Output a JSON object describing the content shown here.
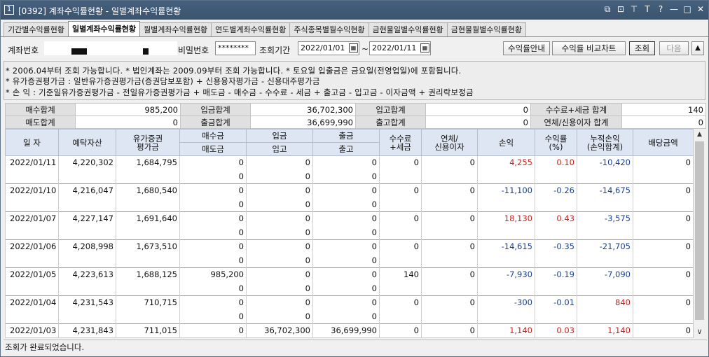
{
  "window": {
    "num": "1",
    "title": "[0392] 계좌수익률현황 - 일별계좌수익률현황",
    "buttons": [
      "⧉",
      "⊡",
      "⊤",
      "T",
      "?",
      "—",
      "□",
      "✕"
    ]
  },
  "tabs": [
    "기간별수익률현황",
    "일별계좌수익률현황",
    "월별계좌수익률현황",
    "연도별계좌수익률현황",
    "주식종목별월수익현황",
    "금현물일별수익률현황",
    "금현물월별수익률현황"
  ],
  "form": {
    "account_label": "계좌번호",
    "password_label": "비밀번호",
    "password_value": "********",
    "period_label": "조회기간",
    "date_from": "2022/01/01",
    "date_to": "2022/01/11",
    "tilde": "~",
    "cal_icon": "▦",
    "btn_guide": "수익률안내",
    "btn_compare": "수익률 비교차트",
    "btn_query": "조회",
    "btn_next": "다음",
    "btn_up": "▲"
  },
  "notes": [
    "* 2006.04부터 조회 가능합니다.   * 법인계좌는 2009.09부터 조회 가능합니다.   * 토요일 입출금은 금요일(전영업일)에 포함됩니다.",
    "* 유가증권평가금 : 일반유가증권평가금(증권담보포함) + 신용융자평가금 - 신용대주평가금",
    "* 손        익 : 기준일유가증권평가금 - 전일유가증권평가금 + 매도금 - 매수금 - 수수료 - 세금 + 출고금 - 입고금 - 이자금액 + 권리락보정금"
  ],
  "summary": [
    {
      "l1": "매수합계",
      "v1": "985,200",
      "l2": "입금합계",
      "v2": "36,702,300",
      "l3": "입고합계",
      "v3": "0",
      "l4": "수수료+세금 합계",
      "v4": "140"
    },
    {
      "l1": "매도합계",
      "v1": "0",
      "l2": "출금합계",
      "v2": "36,699,990",
      "l3": "출고합계",
      "v3": "0",
      "l4": "연체/신용이자 합계",
      "v4": "0"
    }
  ],
  "headers": {
    "date": "일 자",
    "deposit": "예탁자산",
    "sec_eval": "유가증권\n평가금",
    "buy": "매수금",
    "sell": "매도금",
    "in": "입금",
    "in2": "입고",
    "out": "출금",
    "out2": "출고",
    "fee": "수수료\n+세금",
    "interest": "연체/\n신용이자",
    "pl": "손익",
    "rate": "수익률\n(%)",
    "cum": "누적손익\n(손익합계)",
    "div": "배당금액"
  },
  "rows": [
    {
      "date": "2022/01/11",
      "deposit": "4,220,302",
      "eval": "1,684,795",
      "buy": "0",
      "sell": "0",
      "dep": "0",
      "inq": "0",
      "wd": "0",
      "outq": "0",
      "fee": "0",
      "int": "0",
      "pl": "4,255",
      "rate": "0.10",
      "cum": "-10,420",
      "div": "0",
      "pl_c": "red",
      "rate_c": "red",
      "cum_c": "blue"
    },
    {
      "date": "2022/01/10",
      "deposit": "4,216,047",
      "eval": "1,680,540",
      "buy": "0",
      "sell": "0",
      "dep": "0",
      "inq": "0",
      "wd": "0",
      "outq": "0",
      "fee": "0",
      "int": "0",
      "pl": "-11,100",
      "rate": "-0.26",
      "cum": "-14,675",
      "div": "0",
      "pl_c": "blue",
      "rate_c": "blue",
      "cum_c": "blue"
    },
    {
      "date": "2022/01/07",
      "deposit": "4,227,147",
      "eval": "1,691,640",
      "buy": "0",
      "sell": "0",
      "dep": "0",
      "inq": "0",
      "wd": "0",
      "outq": "0",
      "fee": "0",
      "int": "0",
      "pl": "18,130",
      "rate": "0.43",
      "cum": "-3,575",
      "div": "0",
      "pl_c": "red",
      "rate_c": "red",
      "cum_c": "blue"
    },
    {
      "date": "2022/01/06",
      "deposit": "4,208,998",
      "eval": "1,673,510",
      "buy": "0",
      "sell": "0",
      "dep": "0",
      "inq": "0",
      "wd": "0",
      "outq": "0",
      "fee": "0",
      "int": "0",
      "pl": "-14,615",
      "rate": "-0.35",
      "cum": "-21,705",
      "div": "0",
      "pl_c": "blue",
      "rate_c": "blue",
      "cum_c": "blue"
    },
    {
      "date": "2022/01/05",
      "deposit": "4,223,613",
      "eval": "1,688,125",
      "buy": "985,200",
      "sell": "0",
      "dep": "0",
      "inq": "0",
      "wd": "0",
      "outq": "0",
      "fee": "140",
      "int": "0",
      "pl": "-7,930",
      "rate": "-0.19",
      "cum": "-7,090",
      "div": "0",
      "pl_c": "blue",
      "rate_c": "blue",
      "cum_c": "blue"
    },
    {
      "date": "2022/01/04",
      "deposit": "4,231,543",
      "eval": "710,715",
      "buy": "0",
      "sell": "0",
      "dep": "0",
      "inq": "0",
      "wd": "0",
      "outq": "0",
      "fee": "0",
      "int": "0",
      "pl": "-300",
      "rate": "-0.01",
      "cum": "840",
      "div": "0",
      "pl_c": "blue",
      "rate_c": "blue",
      "cum_c": "red"
    },
    {
      "date": "2022/01/03",
      "deposit": "4,231,843",
      "eval": "711,015",
      "buy": "0",
      "sell": "",
      "dep": "36,702,300",
      "inq": "",
      "wd": "36,699,990",
      "outq": "",
      "fee": "0",
      "int": "0",
      "pl": "1,140",
      "rate": "0.03",
      "cum": "1,140",
      "div": "0",
      "pl_c": "red",
      "rate_c": "red",
      "cum_c": "red"
    }
  ],
  "scroll": {
    "up": "▲",
    "down": "∨"
  },
  "status": "조회가 완료되었습니다."
}
